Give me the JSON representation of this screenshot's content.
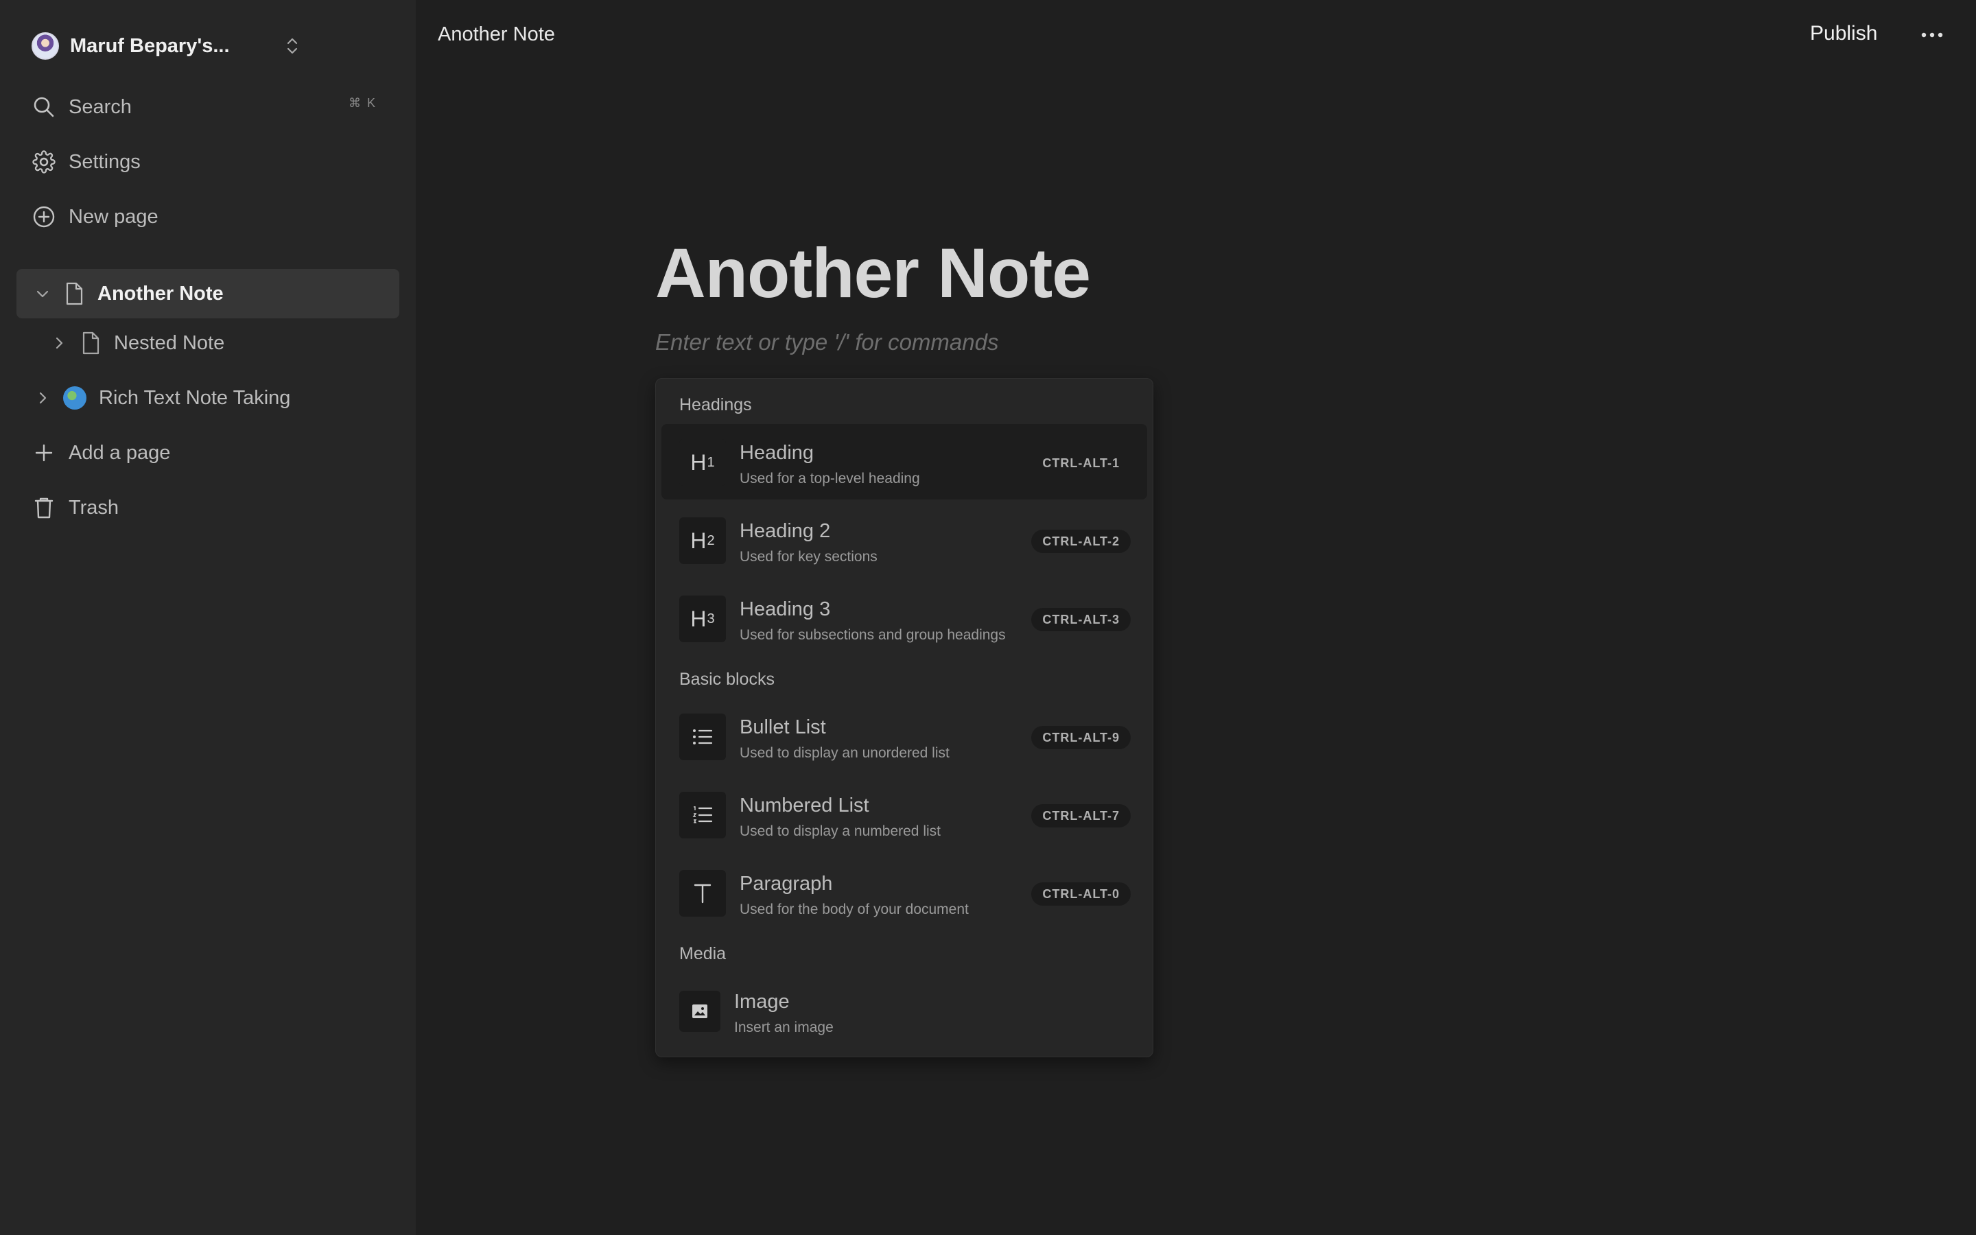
{
  "sidebar": {
    "workspace_name": "Maruf Bepary's...",
    "search_label": "Search",
    "search_shortcut": "⌘ K",
    "settings_label": "Settings",
    "new_page_label": "New page",
    "pages": [
      {
        "label": "Another Note",
        "icon": "file-icon",
        "expanded": true,
        "active": true
      },
      {
        "label": "Nested Note",
        "icon": "file-icon",
        "expanded": false,
        "active": false
      },
      {
        "label": "Rich Text Note Taking",
        "icon": "globe-emoji-icon",
        "expanded": false,
        "active": false
      }
    ],
    "add_page_label": "Add a page",
    "trash_label": "Trash"
  },
  "topbar": {
    "title": "Another Note",
    "publish_label": "Publish",
    "more_icon": "ellipsis-icon"
  },
  "document": {
    "title": "Another Note",
    "placeholder": "Enter text or type '/' for commands"
  },
  "command_menu": {
    "groups": [
      {
        "title": "Headings",
        "items": [
          {
            "icon": "H1",
            "title": "Heading",
            "subtitle": "Used for a top-level heading",
            "shortcut": "CTRL-ALT-1"
          },
          {
            "icon": "H2",
            "title": "Heading 2",
            "subtitle": "Used for key sections",
            "shortcut": "CTRL-ALT-2"
          },
          {
            "icon": "H3",
            "title": "Heading 3",
            "subtitle": "Used for subsections and group headings",
            "shortcut": "CTRL-ALT-3"
          }
        ]
      },
      {
        "title": "Basic blocks",
        "items": [
          {
            "icon": "bullet-list-icon",
            "title": "Bullet List",
            "subtitle": "Used to display an unordered list",
            "shortcut": "CTRL-ALT-9"
          },
          {
            "icon": "numbered-list-icon",
            "title": "Numbered List",
            "subtitle": "Used to display a numbered list",
            "shortcut": "CTRL-ALT-7"
          },
          {
            "icon": "T",
            "title": "Paragraph",
            "subtitle": "Used for the body of your document",
            "shortcut": "CTRL-ALT-0"
          }
        ]
      },
      {
        "title": "Media",
        "items": [
          {
            "icon": "image-icon",
            "title": "Image",
            "subtitle": "Insert an image",
            "shortcut": ""
          }
        ]
      }
    ]
  },
  "colors": {
    "sidebar_bg": "#262626",
    "main_bg": "#1f1f1f",
    "active_item_bg": "#363636",
    "menu_bg": "#262626"
  }
}
